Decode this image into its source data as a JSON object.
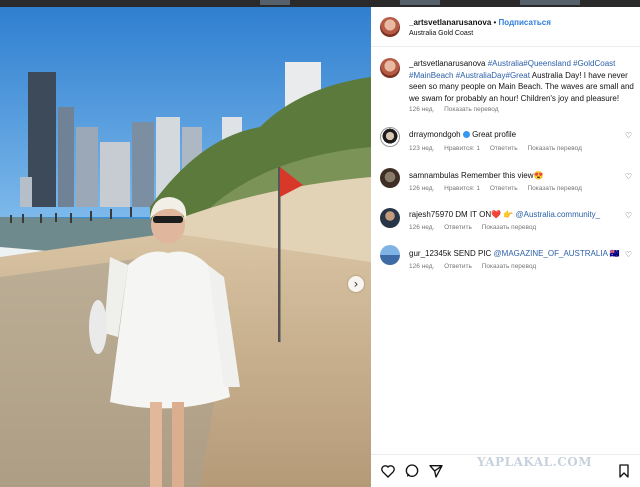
{
  "post": {
    "author": "_artsvetlanarusanova",
    "separator": "•",
    "follow_label": "Подписаться",
    "location": "Australia Gold Coast"
  },
  "caption": {
    "author": "_artsvetlanarusanova",
    "hashtags": "#Australia#Queensland #GoldCoast #MainBeach #AustraliaDay#Great",
    "text": "Australia Day! I have never seen so many people on Main Beach. The waves are small and we swam for probably an hour! Children's joy and pleasure!",
    "age": "126 нед.",
    "translate": "Показать перевод"
  },
  "comments": [
    {
      "user": "drraymondgoh",
      "verified": true,
      "text": "Great profile",
      "age": "123 нед.",
      "likes": "Нравится: 1",
      "reply": "Ответить",
      "translate": "Показать перевод"
    },
    {
      "user": "samnambulas",
      "text": "Remember this view😍",
      "age": "126 нед.",
      "likes": "Нравится: 1",
      "reply": "Ответить",
      "translate": "Показать перевод"
    },
    {
      "user": "rajesh75970",
      "text": "DM IT ON❤️ 👉",
      "mention": "@Australia.community_",
      "age": "126 нед.",
      "reply": "Ответить",
      "translate": "Показать перевод"
    },
    {
      "user": "gur_12345k",
      "text": "SEND PIC",
      "mention": "@MAGAZINE_OF_AUSTRALIA",
      "flag": "🇦🇺",
      "age": "126 нед.",
      "reply": "Ответить",
      "translate": "Показать перевод"
    }
  ],
  "watermark": "YAPLAKAL.COM",
  "icons": [
    "heart-icon",
    "comment-icon",
    "share-icon",
    "bookmark-icon",
    "chevron-right-icon"
  ],
  "colors": {
    "accent": "#2f7ed8",
    "link": "#2b5fa8"
  }
}
